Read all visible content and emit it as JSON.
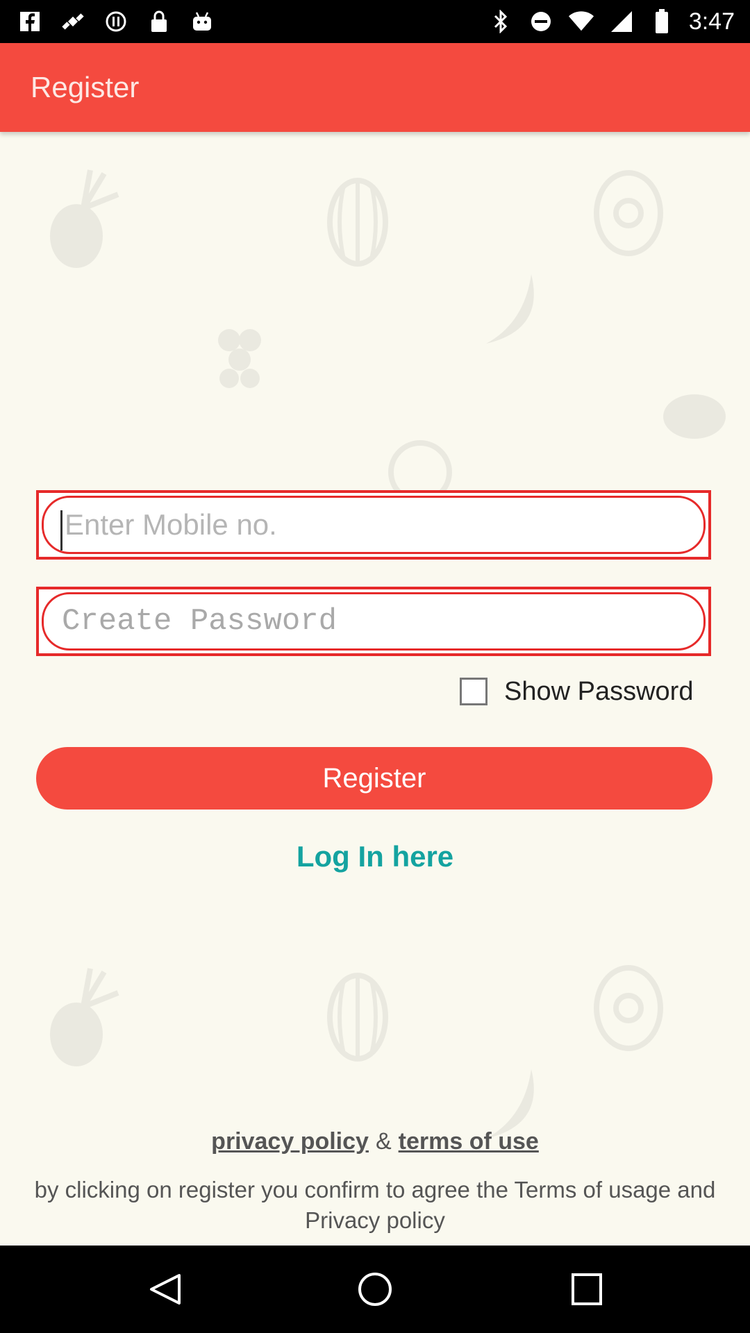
{
  "status_bar": {
    "time": "3:47",
    "left_icons": [
      "facebook-icon",
      "satellite-fake-gps-icon",
      "media-icon",
      "lock-icon",
      "android-icon"
    ],
    "right_icons": [
      "bluetooth-icon",
      "do-not-disturb-icon",
      "wifi-icon",
      "signal-icon",
      "battery-icon"
    ]
  },
  "app_bar": {
    "title": "Register"
  },
  "form": {
    "mobile_placeholder": "Enter Mobile no.",
    "password_placeholder": "Create Password",
    "show_password_label": "Show Password",
    "register_button": "Register",
    "login_link": "Log In here"
  },
  "footer": {
    "privacy_policy": "privacy policy",
    "ampersand": "&",
    "terms_of_use": "terms of use",
    "consent_text": "by clicking on register you confirm to agree the Terms of usage and Privacy policy"
  },
  "nav_bar": {
    "buttons": [
      "back-icon",
      "home-icon",
      "recents-icon"
    ]
  },
  "colors": {
    "accent": "#f44a3f",
    "link": "#14a3a0",
    "field_border": "#e62a2a",
    "background": "#faf9ef"
  }
}
